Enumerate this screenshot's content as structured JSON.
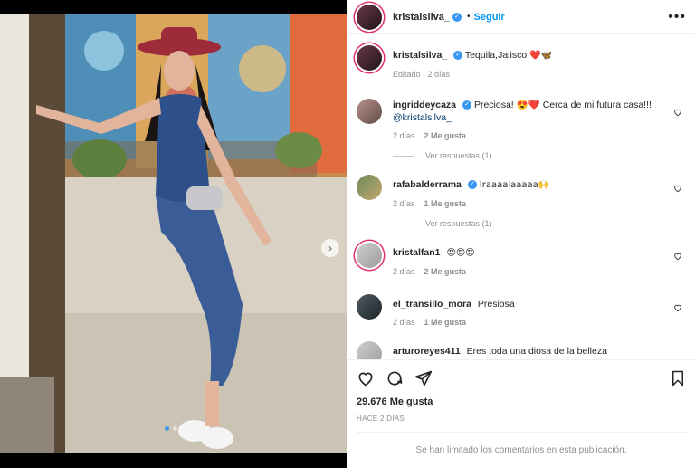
{
  "post": {
    "username": "kristalsilva_",
    "follow_label": "Seguir",
    "separator": "•",
    "more_label": "•••",
    "caption": "Tequila,Jalisco",
    "caption_emoji": "❤️🦋",
    "edited_label": "Editado · 2 días"
  },
  "comments": [
    {
      "user": "ingriddeycaza",
      "verified": true,
      "text": "Preciosa! 😍❤️ Cerca de mi futura casa!!!",
      "mention": "@kristalsilva_",
      "age": "2 días",
      "likes": "2 Me gusta",
      "replies": "Ver respuestas (1)"
    },
    {
      "user": "rafabalderrama",
      "verified": true,
      "text": "Iraaaalaaaaa🙌",
      "age": "2 días",
      "likes": "1 Me gusta",
      "replies": "Ver respuestas (1)"
    },
    {
      "user": "kristalfan1",
      "verified": false,
      "text": "😍😍😍",
      "age": "2 días",
      "likes": "2 Me gusta"
    },
    {
      "user": "el_transillo_mora",
      "verified": false,
      "text": "Presiosa",
      "age": "2 días",
      "likes": "1 Me gusta"
    },
    {
      "user": "arturoreyes411",
      "verified": false,
      "text": "Eres toda una diosa de la belleza"
    }
  ],
  "actions": {
    "likes_total": "29.676 Me gusta",
    "posted": "HACE 2 DÍAS",
    "comments_closed": "Se han limitado los comentarios en esta publicación."
  },
  "media": {
    "carousel_total": 2,
    "carousel_index": 1,
    "next_icon": "chevron-right-icon"
  },
  "colors": {
    "accent": "#0095f6",
    "verified": "#3897f0",
    "muted": "#8e8e8e"
  }
}
